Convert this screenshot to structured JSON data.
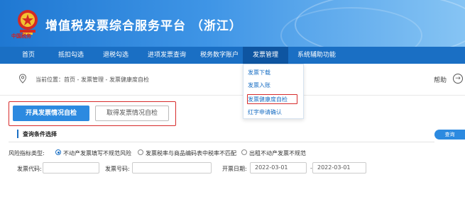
{
  "header": {
    "title": "增值税发票综合服务平台 （浙江）",
    "logo_text": "中国税务"
  },
  "nav": {
    "items": [
      {
        "label": "首页",
        "active": false
      },
      {
        "label": "抵扣勾选",
        "active": false
      },
      {
        "label": "退税勾选",
        "active": false
      },
      {
        "label": "进项发票查询",
        "active": false
      },
      {
        "label": "税务数字账户",
        "active": false
      },
      {
        "label": "发票管理",
        "active": true
      },
      {
        "label": "系统辅助功能",
        "active": false
      }
    ]
  },
  "dropdown": {
    "items": [
      "发票下载",
      "发票入账",
      "发票健康度自检",
      "红字申请确认"
    ],
    "highlighted": "发票健康度自检"
  },
  "breadcrumb": {
    "prefix": "当前位置：",
    "path": "首页 - 发票管理 - 发票健康度自检"
  },
  "help": {
    "label": "帮助"
  },
  "tabs": {
    "primary": "开具发票情况自检",
    "secondary": "取得发票情况自检"
  },
  "section": {
    "title": "查询条件选择",
    "query_button": "查询"
  },
  "risk": {
    "label": "风险指标类型:",
    "options": [
      {
        "label": "不动产发票填写不规范风险",
        "checked": true
      },
      {
        "label": "发票税率与商品编码表中税率不匹配",
        "checked": false
      },
      {
        "label": "出租不动产发票不规范",
        "checked": false
      }
    ]
  },
  "filters": {
    "invoice_code_label": "发票代码:",
    "invoice_code_value": "",
    "invoice_number_label": "发票号码:",
    "invoice_number_value": "",
    "date_label": "开票日期:",
    "date_start": "2022-03-01",
    "date_separator": "-",
    "date_end": "2022-03-01"
  },
  "colors": {
    "nav_bg": "#1a6fc4",
    "primary": "#2c8ae0",
    "highlight_border": "#d62b2b"
  }
}
